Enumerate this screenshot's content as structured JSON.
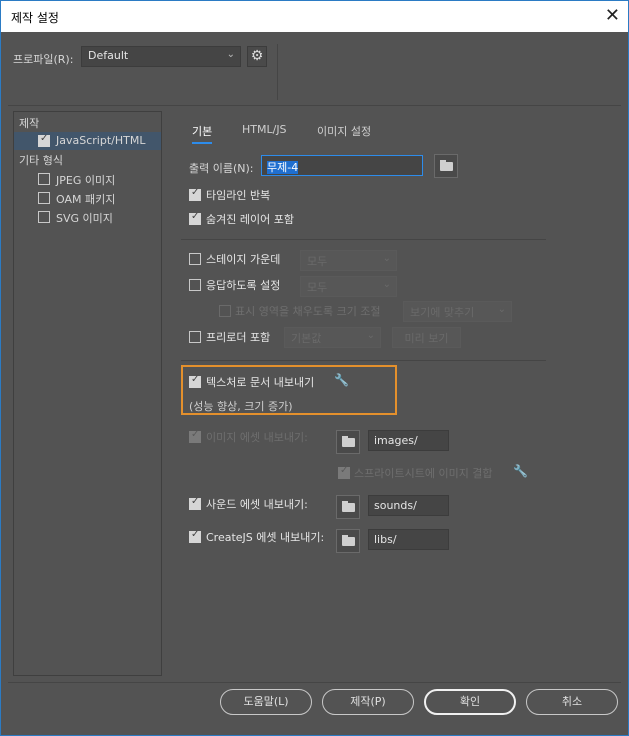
{
  "window": {
    "title": "제작 설정",
    "close": "✕"
  },
  "profile": {
    "label": "프로파일(R):",
    "value": "Default"
  },
  "sidebar": {
    "group1": "제작",
    "items1": [
      {
        "label": "JavaScript/HTML",
        "checked": true
      }
    ],
    "group2": "기타 형식",
    "items2": [
      {
        "label": "JPEG 이미지",
        "checked": false
      },
      {
        "label": "OAM 패키지",
        "checked": false
      },
      {
        "label": "SVG 이미지",
        "checked": false
      }
    ]
  },
  "tabs": [
    "기본",
    "HTML/JS",
    "이미지 설정"
  ],
  "output": {
    "label": "출력 이름(N):",
    "value": "무제-4"
  },
  "opts": {
    "loop": "타임라인 반복",
    "hidden": "숨겨진 레이어 포함",
    "center": "스테이지 가운데",
    "center_sel": "모두",
    "responsive": "응답하도록 설정",
    "responsive_sel": "모두",
    "scale": "표시 영역을 채우도록 크기 조절",
    "scale_sel": "보기에 맞추기",
    "preloader": "프리로더 포함",
    "preloader_sel": "기본값",
    "preview": "미리 보기",
    "texture": "텍스처로 문서 내보내기",
    "texture_note": "(성능 향상, 크기 증가)",
    "images": "이미지 에셋 내보내기:",
    "images_path": "images/",
    "sprite": "스프라이트시트에 이미지 결합",
    "sounds": "사운드 에셋 내보내기:",
    "sounds_path": "sounds/",
    "createjs": "CreateJS 에셋 내보내기:",
    "createjs_path": "libs/"
  },
  "buttons": {
    "help": "도움말(L)",
    "publish": "제작(P)",
    "ok": "확인",
    "cancel": "취소"
  },
  "colors": {
    "highlight": "#e4902c",
    "accent": "#2d8ceb"
  }
}
